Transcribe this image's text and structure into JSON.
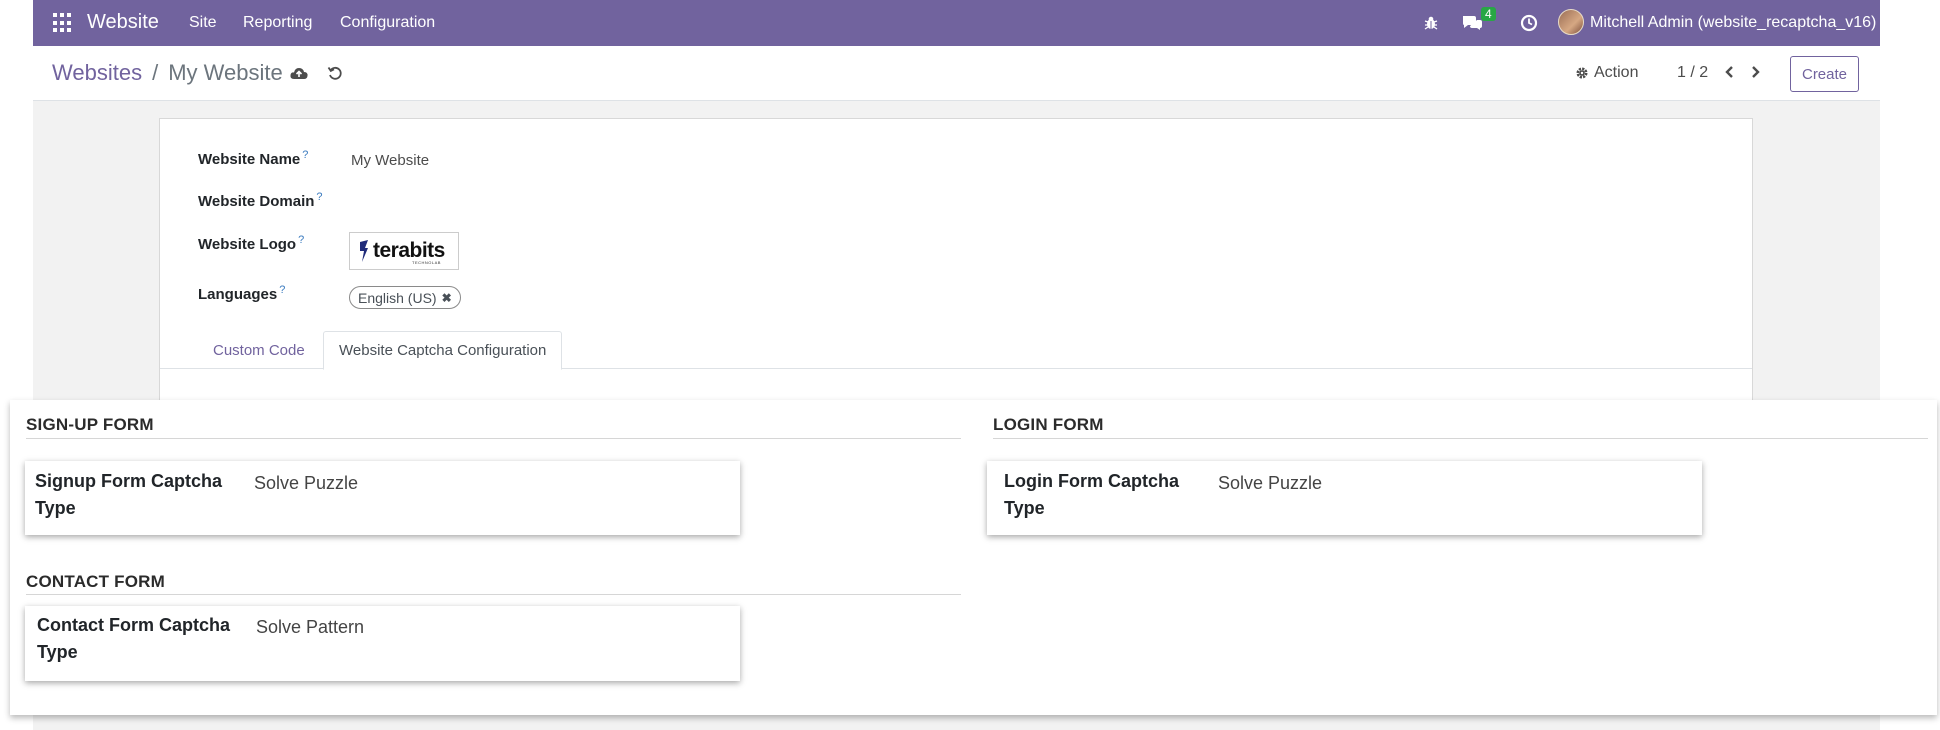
{
  "navbar": {
    "app_name": "Website",
    "menu": [
      "Site",
      "Reporting",
      "Configuration"
    ],
    "messages_count": "4",
    "user": "Mitchell Admin (website_recaptcha_v16)"
  },
  "control_panel": {
    "breadcrumb_parent": "Websites",
    "breadcrumb_separator": "/",
    "breadcrumb_current": "My Website",
    "action_label": "Action",
    "pager": "1 / 2",
    "create_label": "Create"
  },
  "form": {
    "fields": [
      {
        "label": "Website Name",
        "help": "?",
        "value": "My Website"
      },
      {
        "label": "Website Domain",
        "help": "?",
        "value": ""
      },
      {
        "label": "Website Logo",
        "help": "?",
        "value": ""
      },
      {
        "label": "Languages",
        "help": "?",
        "value": ""
      }
    ],
    "logo_text": "terabits",
    "logo_subtext": "TECHNOLAB",
    "languages": [
      "English (US)"
    ],
    "tabs": [
      "Custom Code",
      "Website Captcha Configuration"
    ],
    "active_tab": "Website Captcha Configuration"
  },
  "captcha": {
    "signup": {
      "title": "SIGN-UP FORM",
      "label_line1": "Signup Form Captcha",
      "label_line2": "Type",
      "value": "Solve Puzzle"
    },
    "login": {
      "title": "LOGIN FORM",
      "label_line1": "Login Form Captcha",
      "label_line2": "Type",
      "value": "Solve Puzzle"
    },
    "contact": {
      "title": "CONTACT FORM",
      "label_line1": "Contact Form Captcha",
      "label_line2": "Type",
      "value": "Solve Pattern"
    }
  },
  "colors": {
    "brand": "#71639e",
    "badge": "#28a745"
  },
  "icons": [
    "apps-grid-icon",
    "bug-icon",
    "chat-icon",
    "clock-icon",
    "cloud-upload-icon",
    "discard-icon",
    "gear-icon",
    "chevron-left-icon",
    "chevron-right-icon",
    "close-icon"
  ]
}
